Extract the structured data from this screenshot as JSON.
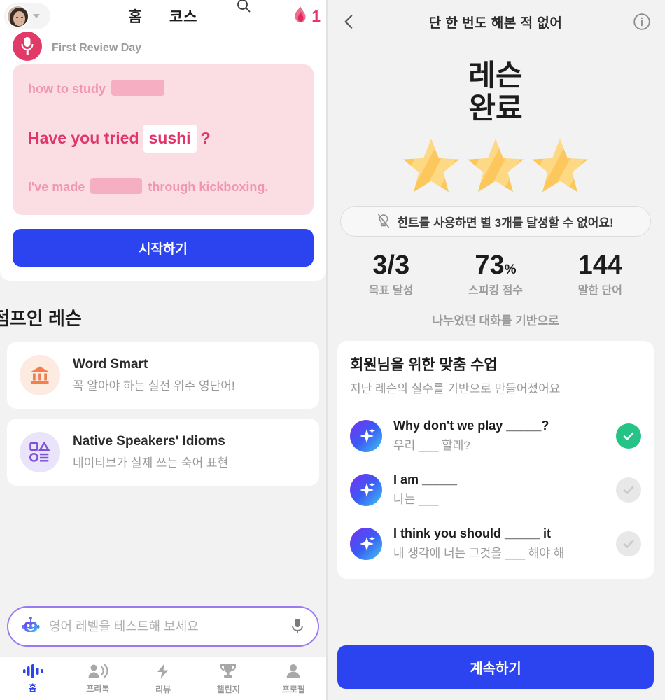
{
  "left": {
    "header": {
      "avatar_name": "user-avatar",
      "dropdown_icon": "chevron-down-icon",
      "search_icon": "search-icon",
      "streak_icon": "flame-icon",
      "streak_count": "1",
      "tabs": [
        {
          "label": "홈",
          "active": true
        },
        {
          "label": "코스",
          "active": false
        }
      ]
    },
    "review": {
      "mic_icon": "microphone-icon",
      "label": "First Review Day",
      "lines": {
        "top_prefix": "how to study",
        "top_blank": "",
        "main_prefix": "Have you tried",
        "main_word": "sushi",
        "main_suffix": "?",
        "bottom_prefix": "I've made",
        "bottom_mid": "through",
        "bottom_suffix": "kickboxing."
      },
      "start_button": "시작하기"
    },
    "section_title": "점프인 레슨",
    "lessons": [
      {
        "icon": "bank-icon",
        "title": "Word Smart",
        "subtitle": "꼭 알아야 하는 실전 위주 영단어!"
      },
      {
        "icon": "shapes-list-icon",
        "title": "Native Speakers' Idioms",
        "subtitle": "네이티브가 실제 쓰는 숙어 표현"
      }
    ],
    "search": {
      "bot_icon": "robot-icon",
      "placeholder": "영어 레벨을 테스트해 보세요",
      "value": "",
      "mic_icon": "microphone-icon"
    },
    "bottom_nav": [
      {
        "label": "홈",
        "icon": "waveform-icon",
        "active": true
      },
      {
        "label": "프리톡",
        "icon": "person-speaking-icon",
        "active": false
      },
      {
        "label": "리뷰",
        "icon": "lightning-icon",
        "active": false
      },
      {
        "label": "챌린지",
        "icon": "trophy-icon",
        "active": false
      },
      {
        "label": "프로필",
        "icon": "person-icon",
        "active": false
      }
    ]
  },
  "right": {
    "header": {
      "back_icon": "chevron-left-icon",
      "title": "단 한 번도 해본 적 없어",
      "info_icon": "info-circle-icon"
    },
    "done_line1": "레슨",
    "done_line2": "완료",
    "stars": [
      {
        "state": "earned"
      },
      {
        "state": "earned"
      },
      {
        "state": "earned"
      }
    ],
    "hint": {
      "icon": "lightbulb-off-icon",
      "text": "힌트를 사용하면 별 3개를 달성할 수 없어요!"
    },
    "stats": [
      {
        "value": "3/3",
        "unit": "",
        "label": "목표 달성"
      },
      {
        "value": "73",
        "unit": "%",
        "label": "스피킹 점수"
      },
      {
        "value": "144",
        "unit": "",
        "label": "말한 단어"
      }
    ],
    "based_on": "나누었던 대화를 기반으로",
    "custom_card": {
      "title": "회원님을 위한 맞춤 수업",
      "subtitle": "지난 레슨의 실수를 기반으로 만들어졌어요",
      "rows": [
        {
          "icon": "sparkle-icon",
          "en": "Why don't we play _____?",
          "ko": "우리 ___ 할래?",
          "status": "done"
        },
        {
          "icon": "sparkle-icon",
          "en": "I am _____",
          "ko": "나는 ___",
          "status": "todo"
        },
        {
          "icon": "sparkle-icon",
          "en": "I think you should _____ it",
          "ko": "내 생각에 너는 그것을 ___ 해야 해",
          "status": "todo"
        }
      ]
    },
    "continue_button": "계속하기"
  },
  "colors": {
    "brand_blue": "#2b44f0",
    "pink_bg": "#fbdde4",
    "pink_text": "#e0356a",
    "pink_muted": "#f196b0",
    "streak_pink": "#e6366b",
    "green_check": "#25c486",
    "star_gold": "#fcc75c",
    "page_bg": "#f2f2f2"
  }
}
